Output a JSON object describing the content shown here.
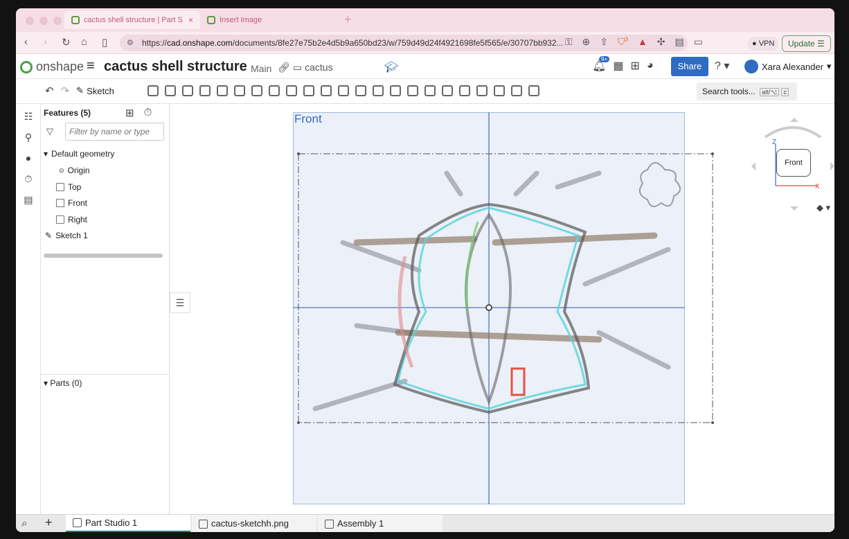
{
  "browser": {
    "tabs": [
      {
        "title": "cactus shell structure | Part S",
        "close": "×"
      },
      {
        "title": "Insert Image"
      }
    ],
    "new_tab": "+",
    "url_prefix": "https://",
    "url_domain": "cad.onshape.com",
    "url_rest": "/documents/8fe27e75b2e4d5b9a650bd23/w/759d49d24f4921698fe5f565/e/30707bb932...",
    "vpn_label": "VPN",
    "update_label": "Update",
    "extension_badge": "3"
  },
  "header": {
    "logo_text": "onshape",
    "doc_title": "cactus shell structure",
    "branch": "Main",
    "folder": "cactus",
    "notification_badge": "9+",
    "share_label": "Share",
    "user_name": "Xara Alexander"
  },
  "toolbar": {
    "sketch_label": "Sketch",
    "search_label": "Search tools...",
    "search_kbd_1": "alt/⌥",
    "search_kbd_2": "c"
  },
  "panel": {
    "title": "Features (5)",
    "filter_placeholder": "Filter by name or type",
    "items": [
      {
        "label": "Default geometry"
      },
      {
        "label": "Origin"
      },
      {
        "label": "Top"
      },
      {
        "label": "Front"
      },
      {
        "label": "Right"
      },
      {
        "label": "Sketch 1"
      }
    ],
    "parts_label": "Parts (0)"
  },
  "viewport": {
    "plane_label": "Front",
    "viewcube_label": "Front",
    "axis_z": "Z",
    "axis_x": "X"
  },
  "bottom_tabs": [
    {
      "label": "Part Studio 1"
    },
    {
      "label": "cactus-sketchh.png"
    },
    {
      "label": "Assembly 1"
    }
  ],
  "colors": {
    "accent": "#2f6bc3",
    "brand_green": "#4aa144",
    "tab_pink": "#f6dde6"
  }
}
